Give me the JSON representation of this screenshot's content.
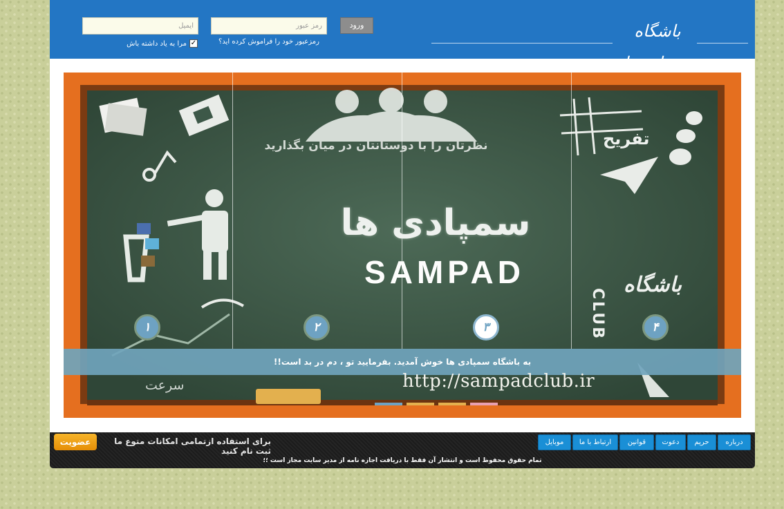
{
  "header": {
    "logo_text": "باشگاه سمپادی‌ها",
    "login_label": "ورود",
    "password_placeholder": "رمز عبور",
    "email_placeholder": "ایمیل",
    "forgot_link": "رمزعبور خود را فراموش کرده اید؟",
    "remember_label": "مرا به یاد داشته باش",
    "remember_checked": true
  },
  "slider": {
    "caption": "به باشگاه سمپادی ها خوش آمدید. بفرمایید تو ، دم در بد است!!",
    "heading": "نظرتان را با دوستانتان در میان بگذارید",
    "title_fa": "سمپادی ها",
    "brand": "SAMPAD",
    "club": "CLUB",
    "fun_label": "تفریح",
    "club_label_fa": "باشگاه",
    "url": "http://sampadclub.ir",
    "speed_label": "سرعت",
    "slots": [
      "۱",
      "۲",
      "۳",
      "۴"
    ],
    "active_slot": 3
  },
  "footer": {
    "nav": [
      {
        "label": "درباره"
      },
      {
        "label": "حریم"
      },
      {
        "label": "دعوت"
      },
      {
        "label": "قوانین"
      },
      {
        "label": "ارتباط با ما"
      },
      {
        "label": "موبایل"
      }
    ],
    "join_text": "برای استفاده ازتمامی امکانات متوع ما ثبت نام کنید",
    "join_button": "عضویت",
    "copyright": "تمام حقوق محفوظ است و انتشار آن فقط با دریافت اجازه نامه از مدیر سایت مجاز است ؛؛"
  },
  "colors": {
    "header_bg": "#2376c4",
    "page_bg": "#c9cf9a",
    "slider_frame": "#e56f1f",
    "chalkboard": "#3d5848",
    "caption_bg": "#70a4bc",
    "nav_button": "#1a8fd6",
    "join_button": "#f2a117"
  }
}
